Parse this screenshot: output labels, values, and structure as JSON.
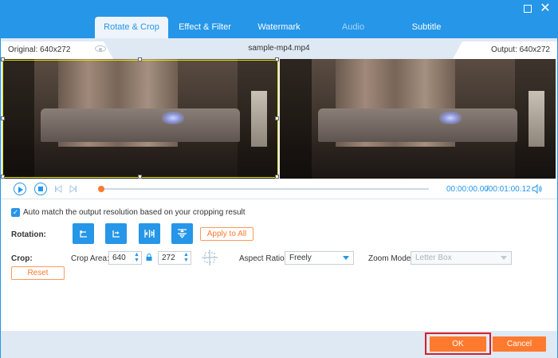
{
  "window": {
    "maximize_icon": "maximize-icon",
    "close_icon": "close-icon",
    "close_glyph": "✕"
  },
  "tabs": [
    {
      "label": "Rotate & Crop",
      "active": true
    },
    {
      "label": "Effect & Filter",
      "active": false
    },
    {
      "label": "Watermark",
      "active": false
    },
    {
      "label": "Audio",
      "active": false
    },
    {
      "label": "Subtitle",
      "active": false
    }
  ],
  "info": {
    "original": "Original: 640x272",
    "filename": "sample-mp4.mp4",
    "output": "Output: 640x272"
  },
  "player": {
    "current_time": "00:00:00.00",
    "total_time": "/00:01:00.12",
    "progress": 0.0
  },
  "options": {
    "auto_match_checked": true,
    "auto_match_label": "Auto match the output resolution based on your cropping result"
  },
  "rotation": {
    "label": "Rotation:",
    "buttons": [
      "rotate-left-icon",
      "rotate-right-icon",
      "flip-horizontal-icon",
      "flip-vertical-icon"
    ],
    "apply_label": "Apply to All"
  },
  "crop": {
    "label": "Crop:",
    "area_label": "Crop Area:",
    "width": "640",
    "height": "272",
    "aspect_label": "Aspect Ratio:",
    "aspect_value": "Freely",
    "zoom_label": "Zoom Mode:",
    "zoom_value": "Letter Box",
    "reset_label": "Reset"
  },
  "footer": {
    "ok_label": "OK",
    "cancel_label": "Cancel"
  },
  "colors": {
    "accent": "#2596e8",
    "action": "#ff7a2f",
    "highlight": "#d81e2a",
    "crop_frame": "#e6e600"
  }
}
